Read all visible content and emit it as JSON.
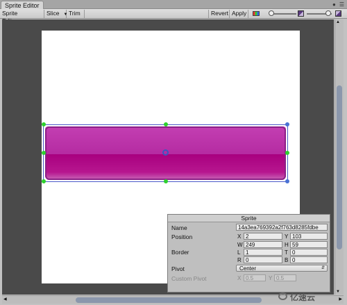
{
  "window": {
    "tab_title": "Sprite Editor"
  },
  "toolbar": {
    "mode_label": "Sprite Editor",
    "slice_label": "Slice",
    "trim_label": "Trim",
    "revert_label": "Revert",
    "apply_label": "Apply",
    "channel_icon": "rgb-channel-icon",
    "zoom_level": 0.05,
    "mip_level": 0.85
  },
  "sprite_panel": {
    "title": "Sprite",
    "name_label": "Name",
    "name_value": "14a3ea769392a2f763d8285fdbe",
    "position_label": "Position",
    "x_label": "X",
    "x_value": "2",
    "y_label": "Y",
    "y_value": "103",
    "w_label": "W",
    "w_value": "249",
    "h_label": "H",
    "h_value": "59",
    "border_label": "Border",
    "l_label": "L",
    "l_value": "1",
    "t_label": "T",
    "t_value": "0",
    "r_label": "R",
    "r_value": "0",
    "b_label": "B",
    "b_value": "0",
    "pivot_label": "Pivot",
    "pivot_value": "Center",
    "custom_pivot_label": "Custom Pivot",
    "cx_label": "X",
    "cx_value": "0.5",
    "cy_label": "Y",
    "cy_value": "0.5"
  },
  "colors": {
    "sprite_top": "#c33fb2",
    "sprite_bottom": "#a8007f",
    "selection": "#4b58c8",
    "handle": "#2ed02e"
  },
  "watermark": {
    "text": "亿速云"
  }
}
